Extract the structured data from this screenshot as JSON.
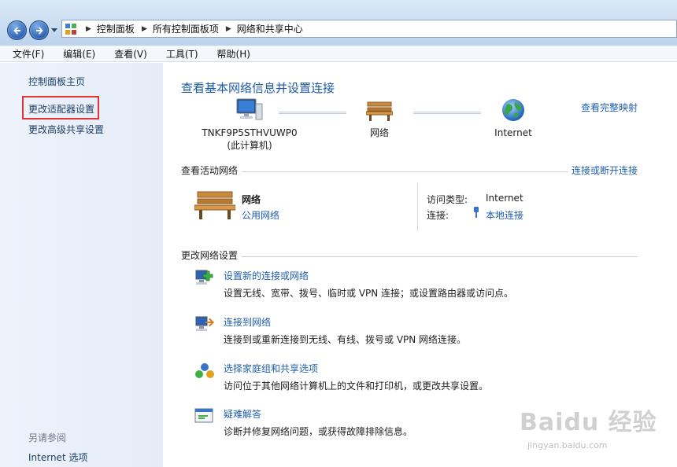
{
  "breadcrumb": {
    "items": [
      "控制面板",
      "所有控制面板项",
      "网络和共享中心"
    ]
  },
  "menu": {
    "items": [
      "文件(F)",
      "编辑(E)",
      "查看(V)",
      "工具(T)",
      "帮助(H)"
    ]
  },
  "sidebar": {
    "home": "控制面板主页",
    "adapter": "更改适配器设置",
    "advanced": "更改高级共享设置",
    "see_also": "另请参阅",
    "internet_options": "Internet 选项"
  },
  "main": {
    "title": "查看基本网络信息并设置连接",
    "full_map": "查看完整映射",
    "map": {
      "computer_name": "TNKF9P5STHVUWP0",
      "computer_sub": "(此计算机)",
      "network": "网络",
      "internet": "Internet"
    },
    "active": {
      "heading": "查看活动网络",
      "connect_link": "连接或断开连接",
      "name": "网络",
      "type": "公用网络",
      "access_label": "访问类型:",
      "access_value": "Internet",
      "conn_label": "连接:",
      "conn_value": "本地连接"
    },
    "change": {
      "heading": "更改网络设置",
      "tasks": [
        {
          "title": "设置新的连接或网络",
          "desc": "设置无线、宽带、拨号、临时或 VPN 连接；或设置路由器或访问点。",
          "icon": "new-connection-icon"
        },
        {
          "title": "连接到网络",
          "desc": "连接到或重新连接到无线、有线、拨号或 VPN 网络连接。",
          "icon": "connect-network-icon"
        },
        {
          "title": "选择家庭组和共享选项",
          "desc": "访问位于其他网络计算机上的文件和打印机，或更改共享设置。",
          "icon": "homegroup-icon"
        },
        {
          "title": "疑难解答",
          "desc": "诊断并修复网络问题，或获得故障排除信息。",
          "icon": "troubleshoot-icon"
        }
      ]
    }
  },
  "watermark": {
    "logo": "Baidu 经验",
    "url": "jingyan.baidu.com"
  },
  "colors": {
    "link": "#1f5fb0",
    "title": "#1e5aa8",
    "highlight_box": "#e53333"
  }
}
